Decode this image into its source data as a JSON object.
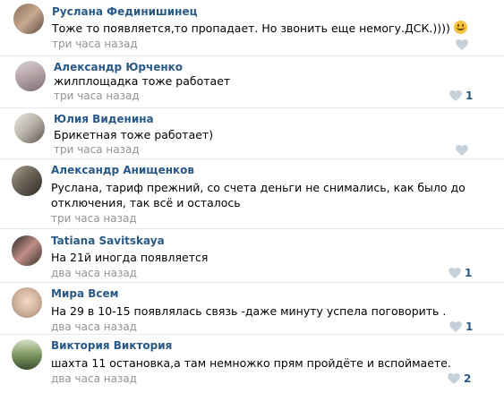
{
  "comments": [
    {
      "author": "Руслана Фединишинец",
      "text": "Тоже то появляется,то пропадает. Но звонить еще немогу.ДСК.))))",
      "emoji": "smile-emoji",
      "time": "три часа назад",
      "likes": ""
    },
    {
      "author": "Александр Юрченко",
      "text": "жилплощадка тоже работает",
      "time": "три часа назад",
      "likes": "1"
    },
    {
      "author": "Юлия Виденина",
      "text": "Брикетная тоже работает)",
      "time": "три часа назад",
      "likes": ""
    },
    {
      "author": "Александр Анищенков",
      "text_line1": "Руслана, тариф прежний, со счета деньги не снимались, как было до",
      "text_line2": "отключения, так всё и осталось",
      "time": "три часа назад",
      "likes": ""
    },
    {
      "author": "Tatiana Savitskaya",
      "text": "На 21й иногда появляется",
      "time": "два часа назад",
      "likes": "1"
    },
    {
      "author": "Мира Всем",
      "text": "На 29 в 10-15 появлялась связь -даже минуту успела поговорить .",
      "time": "два часа назад",
      "likes": "1"
    },
    {
      "author": "Виктория Виктория",
      "text": "шахта 11 остановка,а там немножко прям пройдёте и вспоймаете.",
      "time": "два часа назад",
      "likes": "2"
    }
  ],
  "colors": {
    "name": "#2a5885",
    "meta": "#939393",
    "heart": "#c5d0db"
  }
}
